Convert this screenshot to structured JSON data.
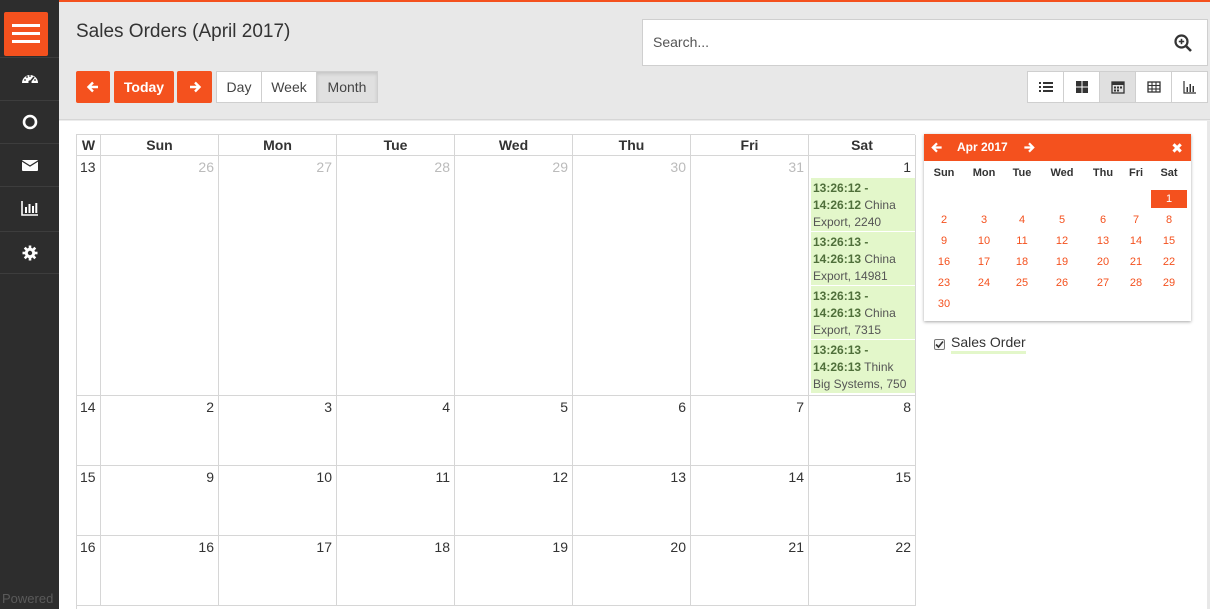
{
  "header": {
    "title": "Sales Orders (April 2017)",
    "search_placeholder": "Search...",
    "today_label": "Today",
    "views": [
      "Day",
      "Week",
      "Month"
    ],
    "active_view": "Month"
  },
  "sidebar": {
    "items": [
      "dashboard-icon",
      "circle-icon",
      "envelope-icon",
      "bar-chart-icon",
      "gear-icon"
    ],
    "footer": "Powered"
  },
  "calendar": {
    "week_header": "W",
    "days": [
      "Sun",
      "Mon",
      "Tue",
      "Wed",
      "Thu",
      "Fri",
      "Sat"
    ],
    "weeks": [
      {
        "week": "13",
        "dates": [
          "26",
          "27",
          "28",
          "29",
          "30",
          "31",
          "1"
        ],
        "other": [
          true,
          true,
          true,
          true,
          true,
          true,
          false
        ]
      },
      {
        "week": "14",
        "dates": [
          "2",
          "3",
          "4",
          "5",
          "6",
          "7",
          "8"
        ],
        "other": [
          false,
          false,
          false,
          false,
          false,
          false,
          false
        ]
      },
      {
        "week": "15",
        "dates": [
          "9",
          "10",
          "11",
          "12",
          "13",
          "14",
          "15"
        ],
        "other": [
          false,
          false,
          false,
          false,
          false,
          false,
          false
        ]
      },
      {
        "week": "16",
        "dates": [
          "16",
          "17",
          "18",
          "19",
          "20",
          "21",
          "22"
        ],
        "other": [
          false,
          false,
          false,
          false,
          false,
          false,
          false
        ]
      }
    ],
    "events": [
      {
        "time": "13:26:12 - 14:26:12",
        "text": "China Export, 2240"
      },
      {
        "time": "13:26:13 - 14:26:13",
        "text": "China Export, 14981"
      },
      {
        "time": "13:26:13 - 14:26:13",
        "text": "China Export, 7315"
      },
      {
        "time": "13:26:13 - 14:26:13",
        "text": "Think Big Systems, 750"
      }
    ],
    "event_color": "#e3f7ca"
  },
  "mini_calendar": {
    "title": "Apr 2017",
    "close": "✖",
    "days": [
      "Sun",
      "Mon",
      "Tue",
      "Wed",
      "Thu",
      "Fri",
      "Sat"
    ],
    "rows": [
      [
        "",
        "",
        "",
        "",
        "",
        "",
        "1"
      ],
      [
        "2",
        "3",
        "4",
        "5",
        "6",
        "7",
        "8"
      ],
      [
        "9",
        "10",
        "11",
        "12",
        "13",
        "14",
        "15"
      ],
      [
        "16",
        "17",
        "18",
        "19",
        "20",
        "21",
        "22"
      ],
      [
        "23",
        "24",
        "25",
        "26",
        "27",
        "28",
        "29"
      ],
      [
        "30",
        "",
        "",
        "",
        "",
        "",
        ""
      ]
    ],
    "selected": "1"
  },
  "legend": {
    "label": "Sales Order",
    "checked": true
  },
  "colors": {
    "accent": "#f4511e",
    "sidebar": "#2d2d2d",
    "header": "#e8e8e8"
  }
}
